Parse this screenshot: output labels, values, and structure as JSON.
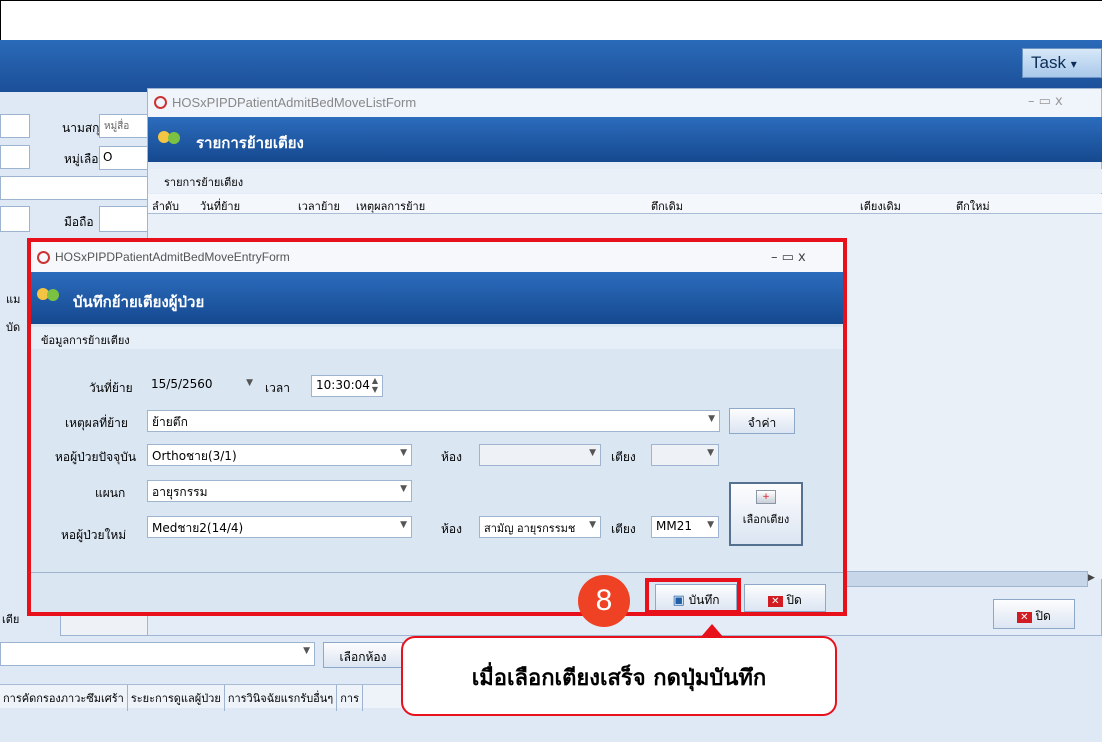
{
  "app": {
    "task_label": "Task",
    "task_arrow": "▾"
  },
  "bg": {
    "lastname_label": "นามสกุล",
    "lastname_value": "หมู่สื่อ",
    "blood_label": "หมู่เลือด",
    "blood_value": "O",
    "mobile_label": "มือถือ",
    "frag1": "แม",
    "frag2": "บัด",
    "frag3": "เตีย",
    "select_room": "เลือกห้อง",
    "close_label": "ปิด"
  },
  "tabs": [
    "การคัดกรองภาวะซึมเศร้า",
    "ระยะการดูแลผู้ป่วย",
    "การวินิจฉัยแรกรับอื่นๆ",
    "การ"
  ],
  "list_form": {
    "window_title": "HOSxPIPDPatientAdmitBedMoveListForm",
    "header": "รายการย้ายเตียง",
    "section": "รายการย้ายเตียง",
    "columns": [
      "ลำดับ",
      "วันที่ย้าย",
      "เวลาย้าย",
      "เหตุผลการย้าย",
      "ตึกเดิม",
      "เตียงเดิม",
      "ตึกใหม่"
    ],
    "win_controls": "–  ▭  x"
  },
  "entry_form": {
    "window_title": "HOSxPIPDPatientAdmitBedMoveEntryForm",
    "header": "บันทึกย้ายเตียงผู้ป่วย",
    "section": "ข้อมูลการย้ายเตียง",
    "win_controls": "–  ▭  x",
    "date_label": "วันที่ย้าย",
    "date_value": "15/5/2560",
    "time_label": "เวลา",
    "time_value": "10:30:04",
    "reason_label": "เหตุผลที่ย้าย",
    "reason_value": "ย้ายตึก",
    "remember_button": "จำค่า",
    "current_ward_label": "หอผู้ป่วยปัจจุบัน",
    "current_ward_value": "Orthoชาย(3/1)",
    "room_label": "ห้อง",
    "bed_label": "เตียง",
    "dept_label": "แผนก",
    "dept_value": "อายุรกรรม",
    "new_ward_label": "หอผู้ป่วยใหม่",
    "new_ward_value": "Medชาย2(14/4)",
    "new_room_value": "สามัญ อายุรกรรมช",
    "new_bed_value": "MM21",
    "select_bed_button": "เลือกเตียง",
    "save_button": "บันทึก",
    "close_button": "ปิด"
  },
  "annotation": {
    "step_number": "8",
    "callout_text": "เมื่อเลือกเตียงเสร็จ กดปุ่มบันทึก"
  },
  "colors": {
    "accent_red": "#e8101b",
    "header_blue": "#1c4f98"
  }
}
